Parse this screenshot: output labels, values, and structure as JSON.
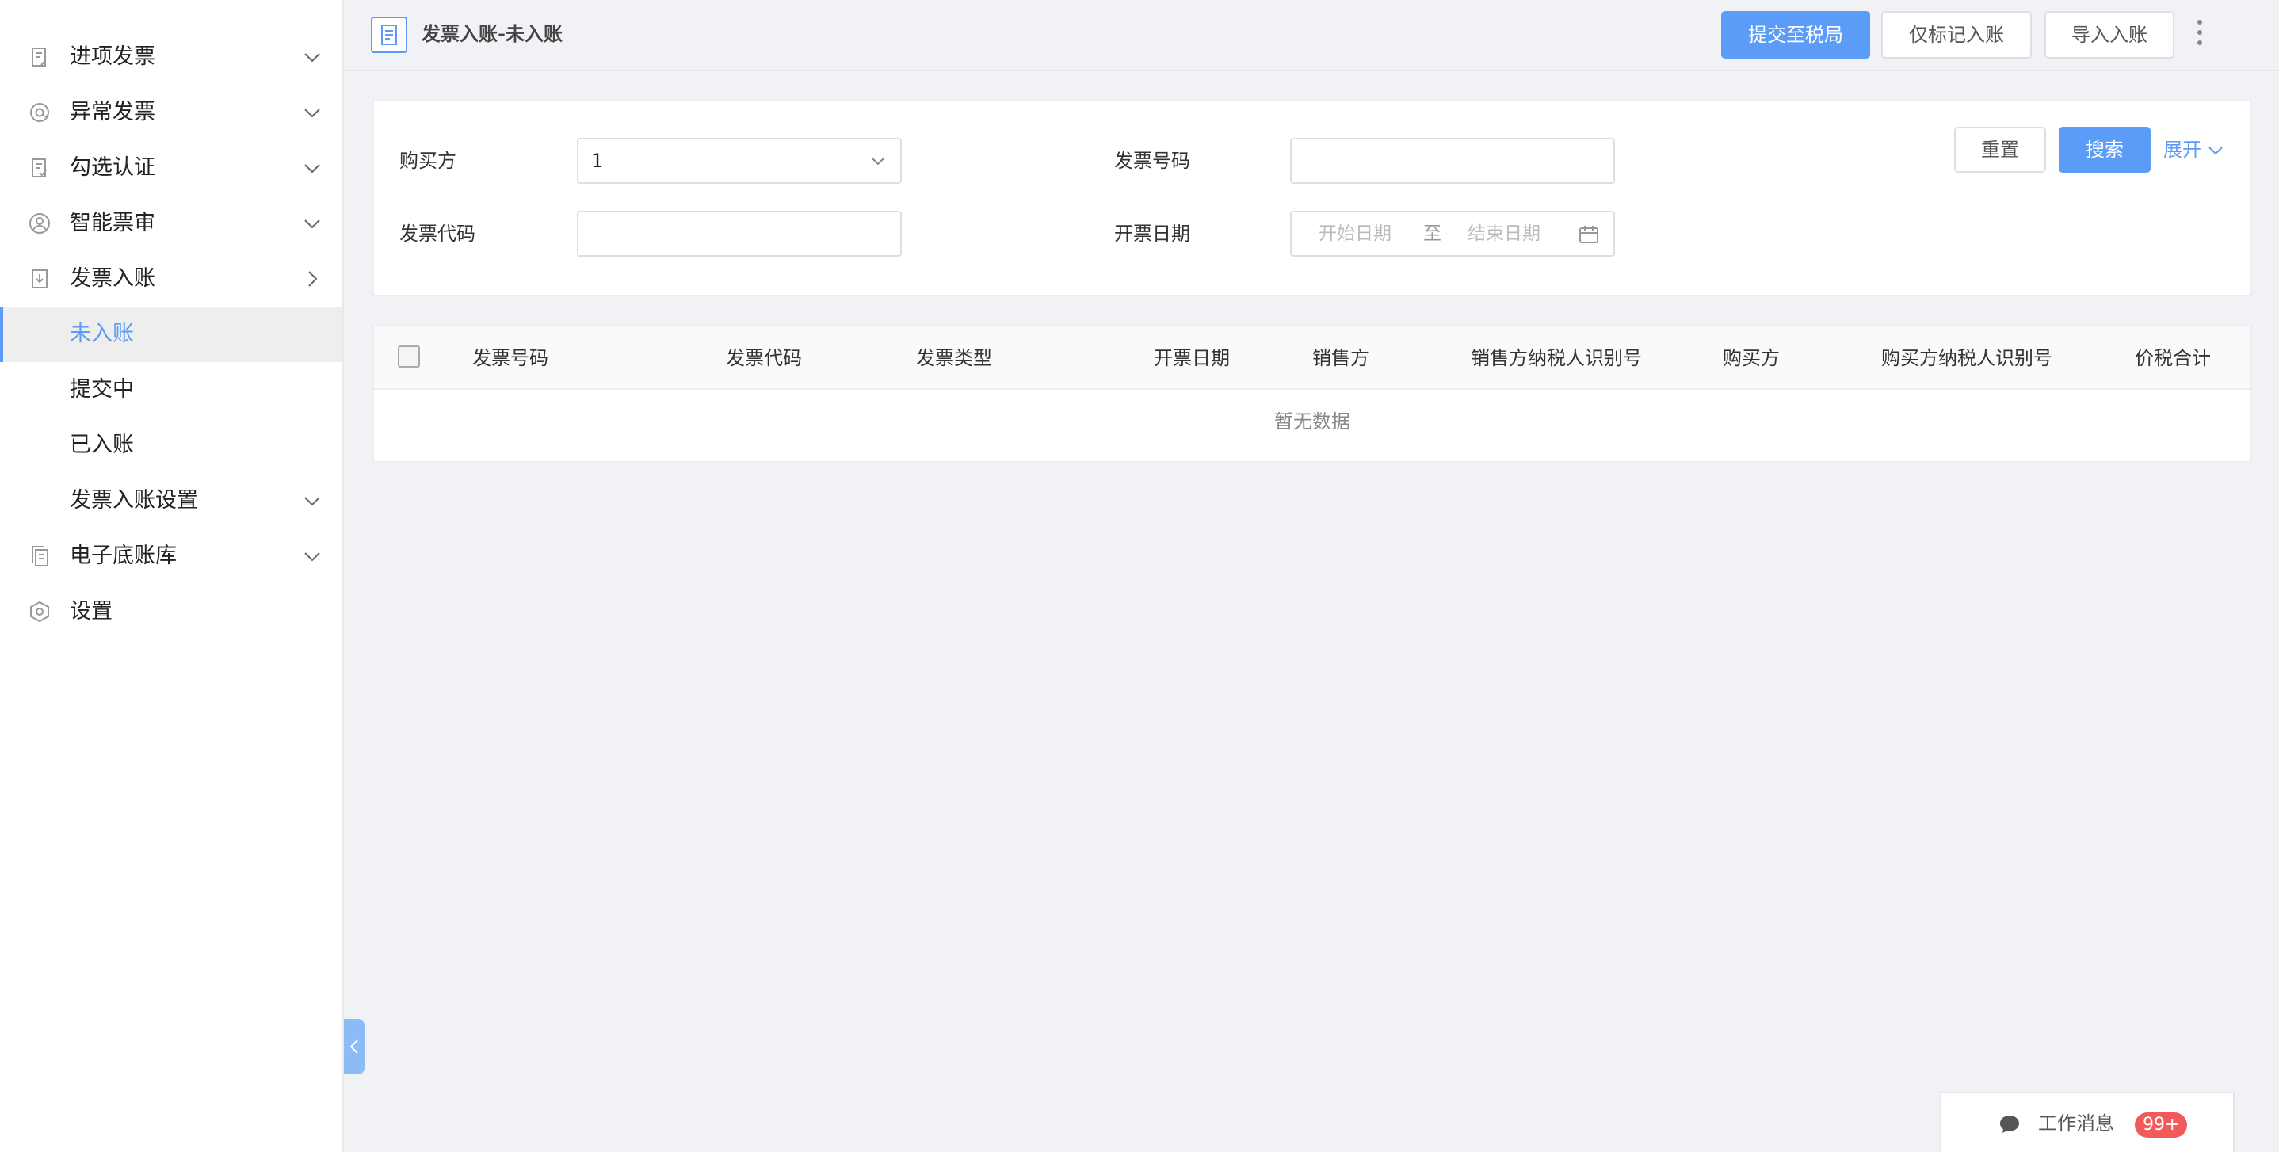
{
  "sidebar": {
    "items": [
      {
        "label": "进项发票",
        "icon": "invoice-in-icon",
        "chevron": "down"
      },
      {
        "label": "异常发票",
        "icon": "at-icon",
        "chevron": "down"
      },
      {
        "label": "勾选认证",
        "icon": "check-doc-icon",
        "chevron": "down"
      },
      {
        "label": "智能票审",
        "icon": "user-circle-icon",
        "chevron": "down"
      },
      {
        "label": "发票入账",
        "icon": "download-doc-icon",
        "chevron": "right"
      },
      {
        "label": "未入账",
        "sub": true,
        "active": true
      },
      {
        "label": "提交中",
        "sub": true
      },
      {
        "label": "已入账",
        "sub": true
      },
      {
        "label": "发票入账设置",
        "sub": true,
        "chevron": "down"
      },
      {
        "label": "电子底账库",
        "icon": "copy-doc-icon",
        "chevron": "down"
      },
      {
        "label": "设置",
        "icon": "hexagon-gear-icon"
      }
    ]
  },
  "header": {
    "title": "发票入账-未入账",
    "submit_label": "提交至税局",
    "mark_label": "仅标记入账",
    "import_label": "导入入账"
  },
  "search": {
    "buyer_label": "购买方",
    "buyer_value": "1",
    "invoice_no_label": "发票号码",
    "invoice_no_value": "",
    "invoice_code_label": "发票代码",
    "invoice_code_value": "",
    "date_label": "开票日期",
    "date_start_placeholder": "开始日期",
    "date_sep": "至",
    "date_end_placeholder": "结束日期",
    "reset_label": "重置",
    "search_label": "搜索",
    "expand_label": "展开"
  },
  "table": {
    "columns": [
      "发票号码",
      "发票代码",
      "发票类型",
      "开票日期",
      "销售方",
      "销售方纳税人识别号",
      "购买方",
      "购买方纳税人识别号",
      "价税合计"
    ],
    "rows": [],
    "empty_text": "暂无数据"
  },
  "messages": {
    "label": "工作消息",
    "badge": "99+"
  },
  "colors": {
    "accent": "#5a9cf8",
    "badge": "#f05a5a"
  }
}
